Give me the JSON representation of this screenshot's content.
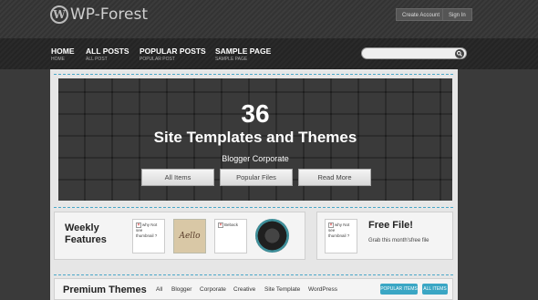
{
  "site": {
    "logo_text": "WP-Forest",
    "logo_icon": "wordpress-icon"
  },
  "account": {
    "create_label": "Create Account",
    "signin_label": "Sign In"
  },
  "nav": {
    "items": [
      {
        "label": "HOME",
        "sub": "HOME"
      },
      {
        "label": "ALL POSTS",
        "sub": "ALL POST"
      },
      {
        "label": "POPULAR POSTS",
        "sub": "POPULAR POST"
      },
      {
        "label": "SAMPLE PAGE",
        "sub": "SAMPLE PAGE"
      }
    ]
  },
  "search": {
    "placeholder": "",
    "icon": "search-icon"
  },
  "hero": {
    "number": "36",
    "title": "Site Templates and Themes",
    "subtitle": "Blogger Corporate",
    "buttons": [
      "All Items",
      "Popular Files",
      "Read More"
    ]
  },
  "weekly": {
    "title": "Weekly Features",
    "thumbs": [
      "why Not see thumbnail ?",
      "Aello",
      "Beback"
    ]
  },
  "free": {
    "title": "Free File!",
    "description": "Grab this month'sfree file",
    "thumb_text": "why Not see thumbnail ?"
  },
  "premium": {
    "title": "Premium Themes",
    "filters": [
      "All",
      "Blogger",
      "Corporate",
      "Creative",
      "Site Template",
      "WordPress"
    ],
    "pills": [
      "POPULAR ITEMS",
      "ALL ITEMS"
    ]
  },
  "colors": {
    "accent": "#3aa6c4",
    "header_bg": "#3a3a3a",
    "content_bg": "#e6e6e6"
  }
}
